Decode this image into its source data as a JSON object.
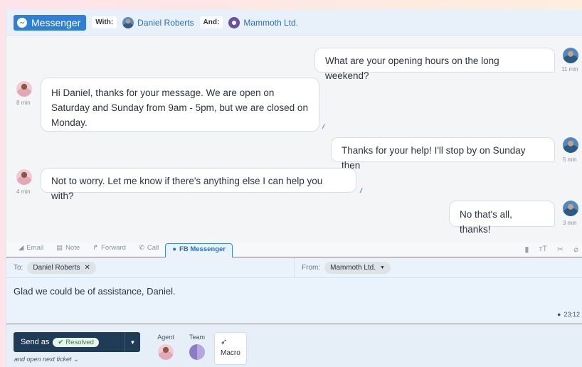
{
  "header": {
    "channel_label": "Messenger",
    "with_label": "With:",
    "customer_name": "Daniel Roberts",
    "and_label": "And:",
    "org_name": "Mammoth Ltd."
  },
  "messages": [
    {
      "side": "out",
      "text": "What are your opening hours on the long weekend?",
      "time": "11 min"
    },
    {
      "side": "in",
      "text": "Hi Daniel, thanks for your message. We are open on Saturday and Sunday from 9am - 5pm, but we are closed on Monday.",
      "time": "8 min"
    },
    {
      "side": "out",
      "text": "Thanks for your help! I'll stop by on Sunday then",
      "time": "5 min"
    },
    {
      "side": "in",
      "text": "Not to worry. Let me know if there's anything else I can help you with?",
      "time": "4 min"
    },
    {
      "side": "out",
      "text": "No that's all, thanks!",
      "time": "3 min"
    }
  ],
  "composer": {
    "tabs": [
      {
        "label": "Email",
        "icon": "send-icon"
      },
      {
        "label": "Note",
        "icon": "note-icon"
      },
      {
        "label": "Forward",
        "icon": "forward-icon"
      },
      {
        "label": "Call",
        "icon": "phone-icon"
      },
      {
        "label": "FB Messenger",
        "icon": "messenger-icon",
        "active": true
      }
    ],
    "to_label": "To:",
    "to_chip": "Daniel Roberts",
    "from_label": "From:",
    "from_chip": "Mammoth Ltd.",
    "body_text": "Glad we could be of assistance, Daniel.",
    "clock_time": "23:12"
  },
  "footer": {
    "send_label": "Send as",
    "status": "Resolved",
    "next_label": "and open next ticket",
    "agent_label": "Agent",
    "team_label": "Team",
    "macro_label": "Macro"
  },
  "colors": {
    "accent": "#2f7fd3",
    "send_bg": "#1f3b55",
    "resolved": "#2e8a47"
  }
}
